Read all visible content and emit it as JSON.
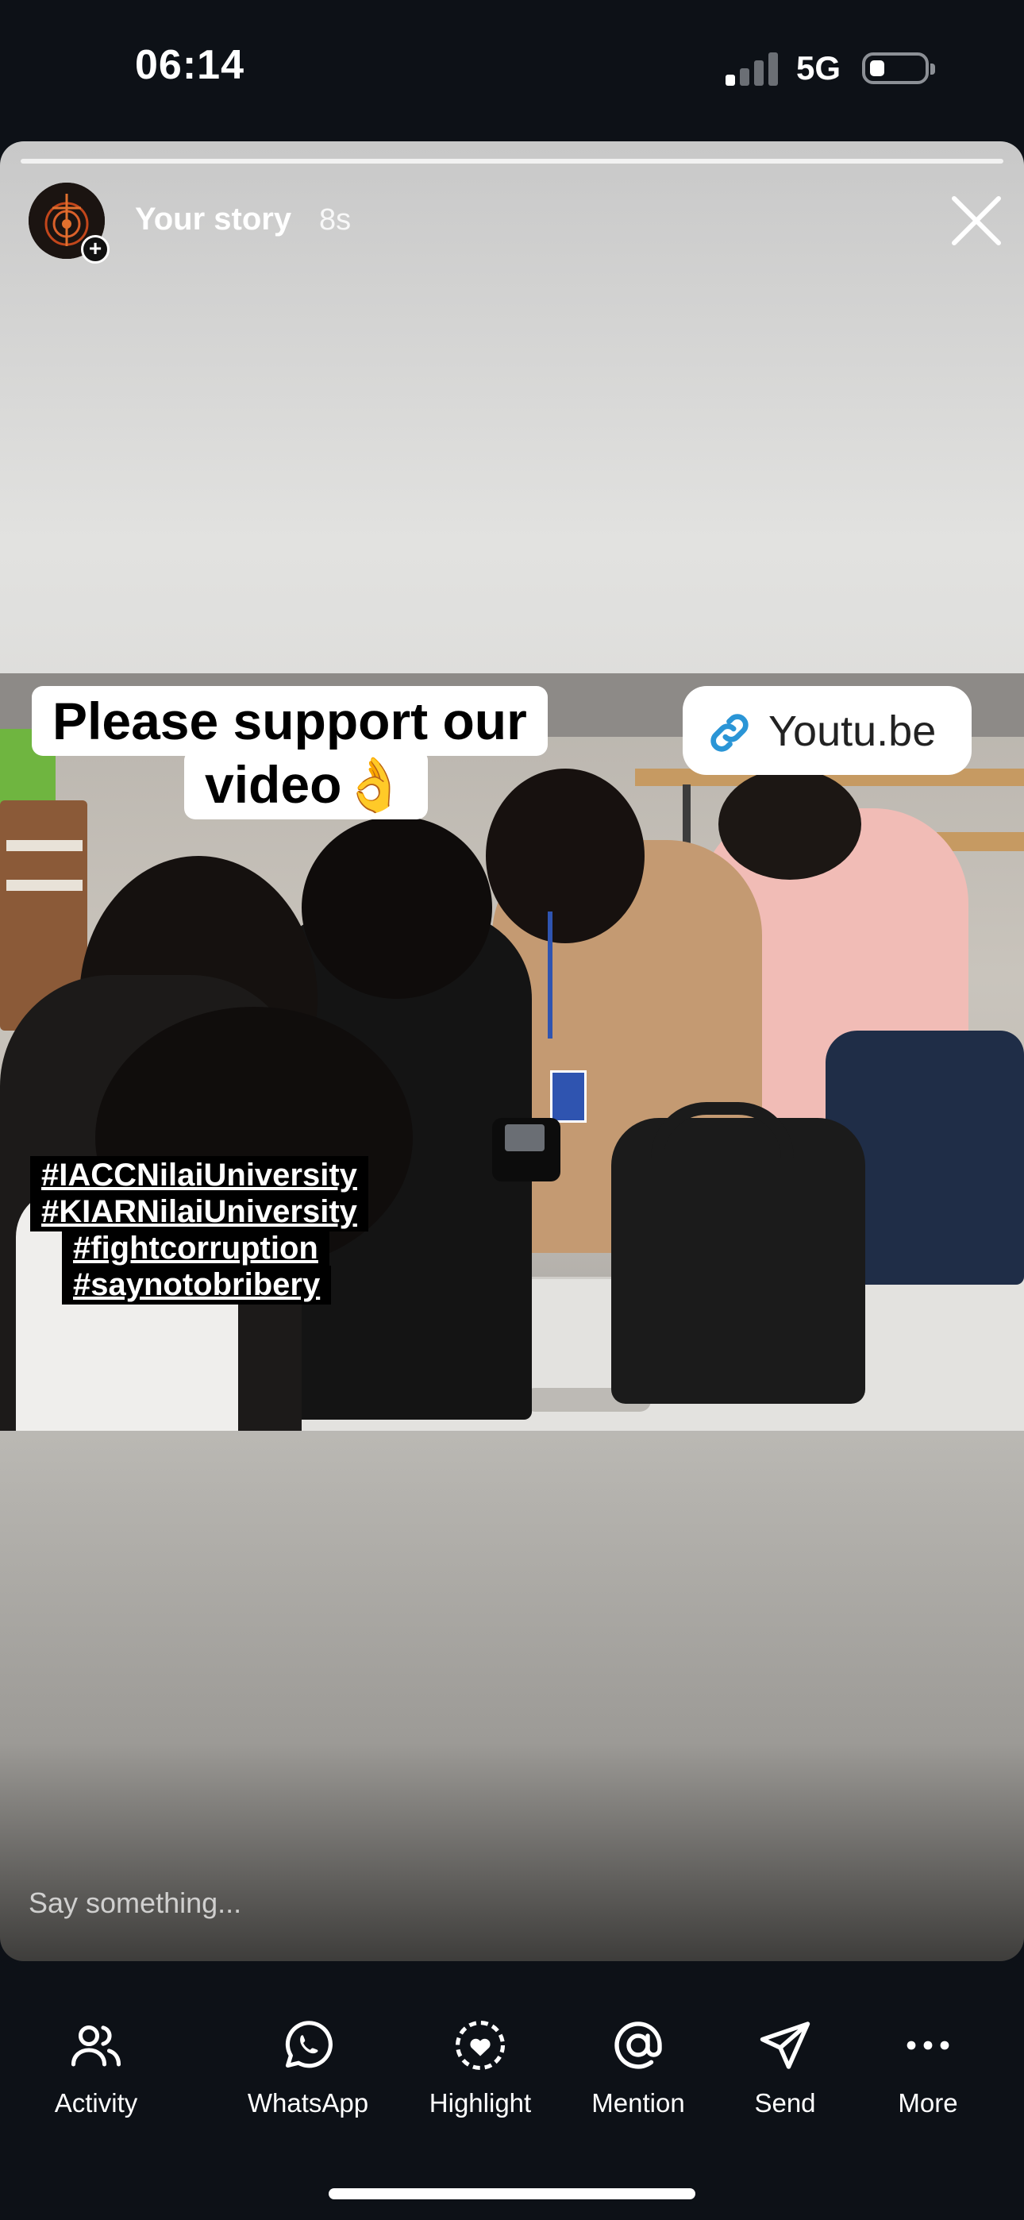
{
  "status_bar": {
    "time": "06:14",
    "network": "5G",
    "signal_bars_on": 1,
    "battery_level": 0.2
  },
  "story": {
    "username": "Your story",
    "age": "8s",
    "caption_line1": "Please support our",
    "caption_line2": "video👌",
    "link_text": "Youtu.be",
    "hashtags": [
      "#IACCNilaiUniversity",
      "#KIARNilaiUniversity",
      "#fightcorruption",
      "#saynotobribery"
    ],
    "reply_placeholder": "Say something..."
  },
  "actions": [
    {
      "label": "Activity",
      "icon": "people-icon"
    },
    {
      "label": "WhatsApp",
      "icon": "whatsapp-icon"
    },
    {
      "label": "Highlight",
      "icon": "highlight-heart-icon"
    },
    {
      "label": "Mention",
      "icon": "at-icon"
    },
    {
      "label": "Send",
      "icon": "send-icon"
    },
    {
      "label": "More",
      "icon": "more-dots-icon"
    }
  ]
}
